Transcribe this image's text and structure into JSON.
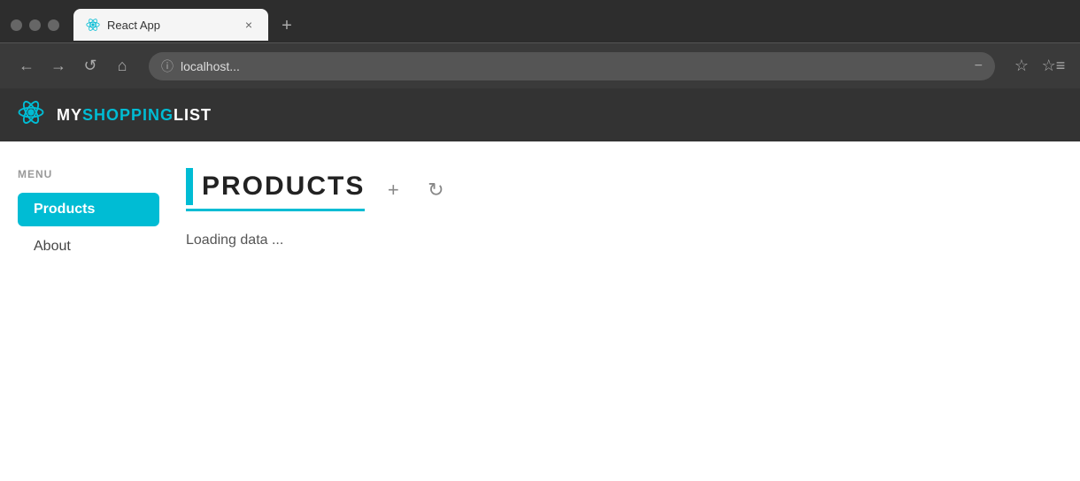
{
  "browser": {
    "tab_title": "React App",
    "tab_close_label": "×",
    "tab_new_label": "+",
    "address_bar_text": "localhost...",
    "nav": {
      "back_label": "←",
      "forward_label": "→",
      "reload_label": "↺",
      "home_label": "⌂"
    },
    "icons": {
      "info": "ⓘ",
      "zoom": "−",
      "star": "☆",
      "bookmarks": "☆≡"
    }
  },
  "app": {
    "brand_prefix": "MY",
    "brand_highlight": "SHOPPING",
    "brand_suffix": "LIST"
  },
  "sidebar": {
    "menu_label": "MENU",
    "items": [
      {
        "label": "Products",
        "active": true
      },
      {
        "label": "About",
        "active": false
      }
    ]
  },
  "main": {
    "page_title": "PRODUCTS",
    "add_btn_label": "+",
    "refresh_btn_label": "↻",
    "loading_text": "Loading data ..."
  }
}
